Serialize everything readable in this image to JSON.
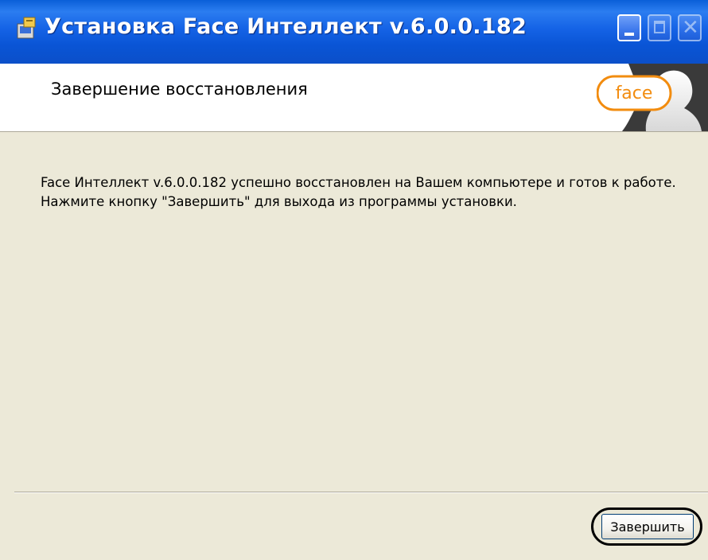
{
  "window": {
    "title": "Установка Face Интеллект v.6.0.0.182",
    "controls": {
      "minimize": "minimize-icon",
      "maximize": "maximize-icon",
      "close": "close-icon"
    }
  },
  "header": {
    "title": "Завершение восстановления",
    "logo_text": "face"
  },
  "body": {
    "message": "Face Интеллект v.6.0.0.182 успешно восстановлен на Вашем компьютере и готов к работе. Нажмите кнопку \"Завершить\" для выхода из программы установки."
  },
  "footer": {
    "finish_label": "Завершить"
  },
  "colors": {
    "titlebar": "#0a55d6",
    "dialog_bg": "#ece9d8",
    "logo_accent": "#f28c0f"
  }
}
